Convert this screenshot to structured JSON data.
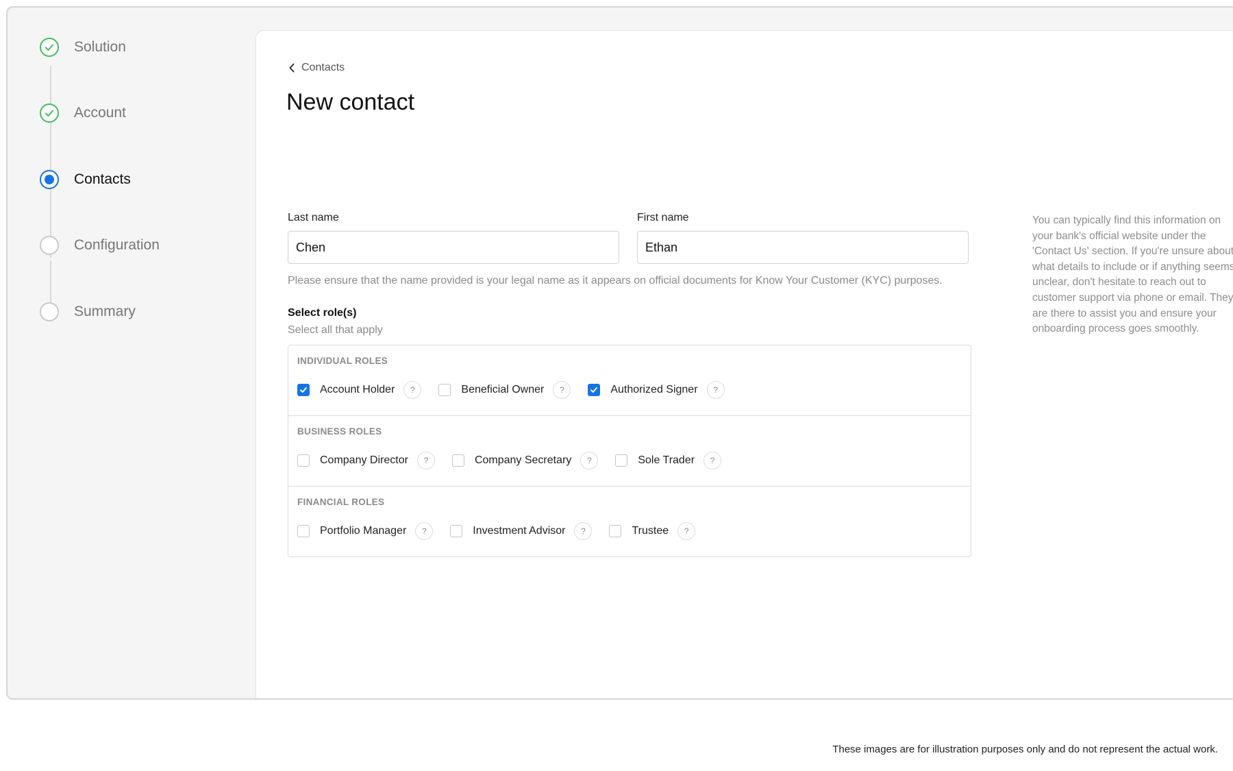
{
  "stepper": {
    "steps": [
      {
        "label": "Solution",
        "state": "done"
      },
      {
        "label": "Account",
        "state": "done"
      },
      {
        "label": "Contacts",
        "state": "active"
      },
      {
        "label": "Configuration",
        "state": "pending"
      },
      {
        "label": "Summary",
        "state": "pending"
      }
    ]
  },
  "breadcrumb": {
    "label": "Contacts",
    "icon": "chevron-left-icon"
  },
  "page": {
    "title": "New contact"
  },
  "form": {
    "last_name": {
      "label": "Last name",
      "value": "Chen"
    },
    "first_name": {
      "label": "First name",
      "value": "Ethan"
    },
    "name_hint": "Please ensure that the name provided is your legal name as it appears on official documents for Know Your Customer (KYC) purposes."
  },
  "roles": {
    "title": "Select role(s)",
    "subtitle": "Select all that apply",
    "help_symbol": "?",
    "groups": [
      {
        "title": "INDIVIDUAL ROLES",
        "items": [
          {
            "label": "Account Holder",
            "checked": true
          },
          {
            "label": "Beneficial Owner",
            "checked": false
          },
          {
            "label": "Authorized Signer",
            "checked": true
          }
        ]
      },
      {
        "title": "BUSINESS ROLES",
        "items": [
          {
            "label": "Company Director",
            "checked": false
          },
          {
            "label": "Company Secretary",
            "checked": false
          },
          {
            "label": "Sole Trader",
            "checked": false
          }
        ]
      },
      {
        "title": "FINANCIAL ROLES",
        "items": [
          {
            "label": "Portfolio Manager",
            "checked": false
          },
          {
            "label": "Investment Advisor",
            "checked": false
          },
          {
            "label": "Trustee",
            "checked": false
          }
        ]
      }
    ]
  },
  "side_note": "You can typically find this information on your bank's official website under the 'Contact Us' section. If you're unsure about what details to include or if anything seems unclear, don't hesitate to reach out to customer support via phone or email. They are there to assist you and ensure your onboarding process goes smoothly.",
  "footer": {
    "disclaimer": "These images are for illustration purposes only and do not represent the actual work."
  },
  "colors": {
    "accent": "#1473e6",
    "success": "#3fbf5b"
  }
}
